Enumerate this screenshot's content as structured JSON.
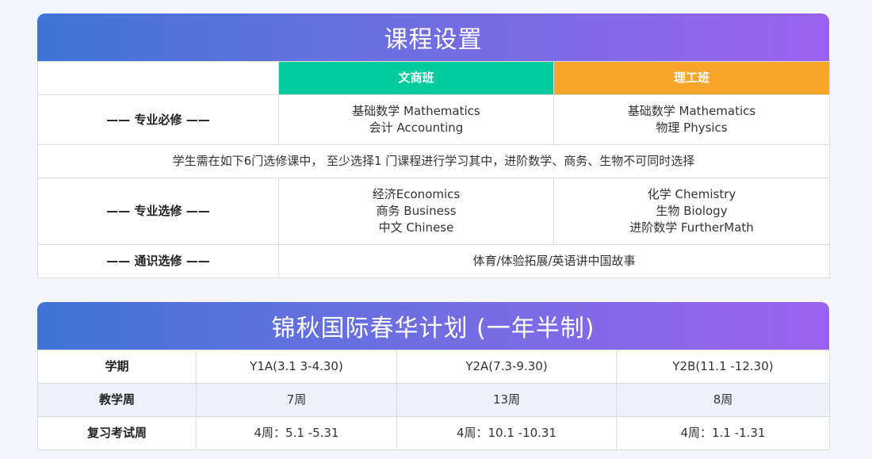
{
  "curriculum": {
    "title": "课程设置",
    "header": {
      "col1": "文商班",
      "col2": "理工班"
    },
    "rows": {
      "required": {
        "label": "—— 专业必修 ——",
        "col1": [
          "基础数学 Mathematics",
          "会计 Accounting"
        ],
        "col2": [
          "基础数学 Mathematics",
          "物理 Physics"
        ]
      },
      "note": "学生需在如下6门选修课中， 至少选择1 门课程进行学习其中，进阶数学、商务、生物不可同时选择",
      "elective": {
        "label": "—— 专业选修 ——",
        "col1": [
          "经济Economics",
          "商务 Business",
          "中文 Chinese"
        ],
        "col2": [
          "化学 Chemistry",
          "生物 Biology",
          "进阶数学 FurtherMath"
        ]
      },
      "general": {
        "label": "—— 通识选修 ——",
        "value": "体育/体验拓展/英语讲中国故事"
      }
    }
  },
  "program": {
    "title": "锦秋国际春华计划 (一年半制)",
    "rows": [
      {
        "label": "学期",
        "cells": [
          "Y1A(3.1 3-4.30)",
          "Y2A(7.3-9.30)",
          "Y2B(11.1 -12.30)"
        ]
      },
      {
        "label": "教学周",
        "cells": [
          "7周",
          "13周",
          "8周"
        ]
      },
      {
        "label": "复习考试周",
        "cells": [
          "4周：5.1 -5.31",
          "4周：10.1 -10.31",
          "4周：1.1 -1.31"
        ]
      }
    ]
  }
}
